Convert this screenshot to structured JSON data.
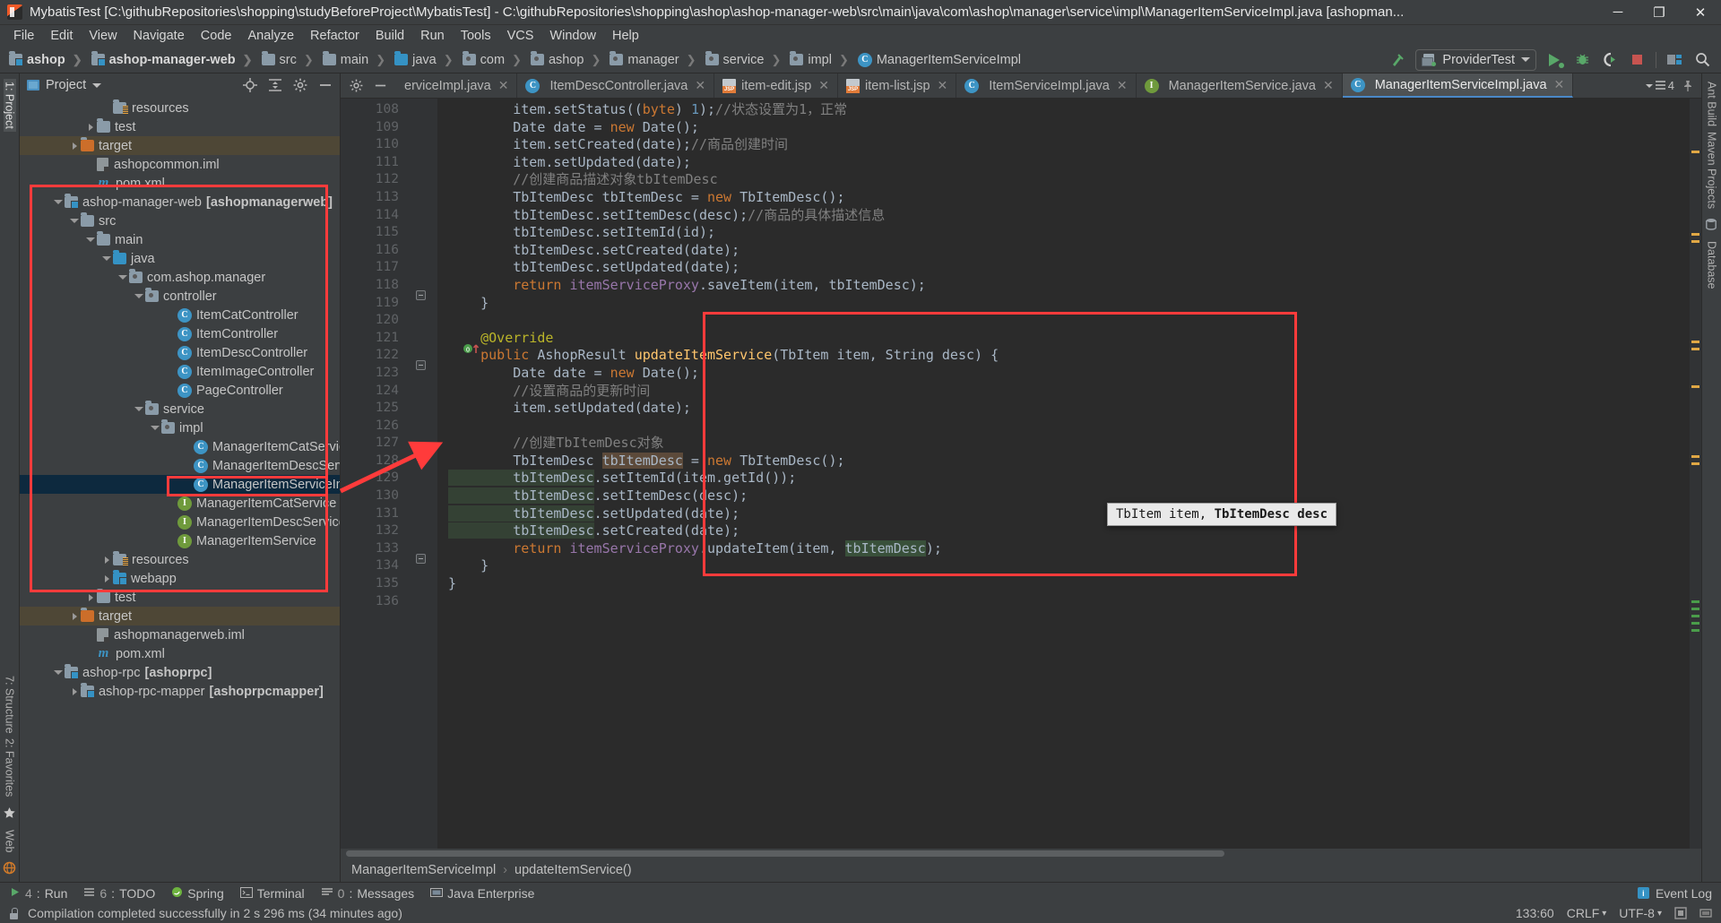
{
  "window": {
    "title": "MybatisTest [C:\\githubRepositories\\shopping\\studyBeforeProject\\MybatisTest] - C:\\githubRepositories\\shopping\\ashop\\ashop-manager-web\\src\\main\\java\\com\\ashop\\manager\\service\\impl\\ManagerItemServiceImpl.java [ashopman...",
    "minimize": "─",
    "maximize": "❐",
    "close": "✕"
  },
  "menu": [
    "File",
    "Edit",
    "View",
    "Navigate",
    "Code",
    "Analyze",
    "Refactor",
    "Build",
    "Run",
    "Tools",
    "VCS",
    "Window",
    "Help"
  ],
  "navbar": {
    "crumbs": [
      {
        "label": "ashop",
        "icon": "module-folder-icon",
        "bold": true
      },
      {
        "label": "ashop-manager-web",
        "icon": "module-folder-icon",
        "bold": true
      },
      {
        "label": "src",
        "icon": "folder-icon",
        "bold": false
      },
      {
        "label": "main",
        "icon": "folder-icon",
        "bold": false
      },
      {
        "label": "java",
        "icon": "source-folder-icon",
        "bold": false
      },
      {
        "label": "com",
        "icon": "package-icon",
        "bold": false
      },
      {
        "label": "ashop",
        "icon": "package-icon",
        "bold": false
      },
      {
        "label": "manager",
        "icon": "package-icon",
        "bold": false
      },
      {
        "label": "service",
        "icon": "package-icon",
        "bold": false
      },
      {
        "label": "impl",
        "icon": "package-icon",
        "bold": false
      },
      {
        "label": "ManagerItemServiceImpl",
        "icon": "class-icon",
        "bold": false
      }
    ],
    "run_config": "ProviderTest"
  },
  "project_panel": {
    "title": "Project",
    "tree": [
      {
        "indent": 5,
        "label": "resources",
        "icon": "resources-folder-icon",
        "arrow": "none",
        "state": "normal"
      },
      {
        "indent": 4,
        "label": "test",
        "icon": "folder-icon",
        "arrow": "closed",
        "state": "normal"
      },
      {
        "indent": 3,
        "label": "target",
        "icon": "target-folder-icon",
        "arrow": "closed",
        "state": "target"
      },
      {
        "indent": 4,
        "label": "ashopcommon.iml",
        "icon": "iml-icon",
        "arrow": "none",
        "state": "normal"
      },
      {
        "indent": 4,
        "label": "pom.xml",
        "icon": "maven-icon",
        "arrow": "none",
        "state": "normal"
      },
      {
        "indent": 2,
        "label": "ashop-manager-web",
        "suffix": "[ashopmanagerweb]",
        "icon": "module-folder-icon",
        "arrow": "open",
        "state": "normal"
      },
      {
        "indent": 3,
        "label": "src",
        "icon": "folder-icon",
        "arrow": "open",
        "state": "normal"
      },
      {
        "indent": 4,
        "label": "main",
        "icon": "folder-icon",
        "arrow": "open",
        "state": "normal"
      },
      {
        "indent": 5,
        "label": "java",
        "icon": "source-folder-icon",
        "arrow": "open",
        "state": "normal"
      },
      {
        "indent": 6,
        "label": "com.ashop.manager",
        "icon": "package-icon",
        "arrow": "open",
        "state": "normal"
      },
      {
        "indent": 7,
        "label": "controller",
        "icon": "package-icon",
        "arrow": "open",
        "state": "normal"
      },
      {
        "indent": 9,
        "label": "ItemCatController",
        "icon": "class-icon",
        "arrow": "none",
        "state": "normal"
      },
      {
        "indent": 9,
        "label": "ItemController",
        "icon": "class-icon",
        "arrow": "none",
        "state": "normal"
      },
      {
        "indent": 9,
        "label": "ItemDescController",
        "icon": "class-icon",
        "arrow": "none",
        "state": "normal"
      },
      {
        "indent": 9,
        "label": "ItemImageController",
        "icon": "class-icon",
        "arrow": "none",
        "state": "normal"
      },
      {
        "indent": 9,
        "label": "PageController",
        "icon": "class-icon",
        "arrow": "none",
        "state": "normal"
      },
      {
        "indent": 7,
        "label": "service",
        "icon": "package-icon",
        "arrow": "open",
        "state": "normal"
      },
      {
        "indent": 8,
        "label": "impl",
        "icon": "package-icon",
        "arrow": "open",
        "state": "normal"
      },
      {
        "indent": 10,
        "label": "ManagerItemCatServiceIm",
        "icon": "class-icon",
        "arrow": "none",
        "state": "normal"
      },
      {
        "indent": 10,
        "label": "ManagerItemDescServiceI",
        "icon": "class-icon",
        "arrow": "none",
        "state": "normal"
      },
      {
        "indent": 10,
        "label": "ManagerItemServiceImpl",
        "icon": "class-icon",
        "arrow": "none",
        "state": "selected"
      },
      {
        "indent": 9,
        "label": "ManagerItemCatService",
        "icon": "interface-icon",
        "arrow": "none",
        "state": "normal"
      },
      {
        "indent": 9,
        "label": "ManagerItemDescService",
        "icon": "interface-icon",
        "arrow": "none",
        "state": "normal"
      },
      {
        "indent": 9,
        "label": "ManagerItemService",
        "icon": "interface-icon",
        "arrow": "none",
        "state": "normal"
      },
      {
        "indent": 5,
        "label": "resources",
        "icon": "resources-folder-icon",
        "arrow": "closed",
        "state": "normal"
      },
      {
        "indent": 5,
        "label": "webapp",
        "icon": "web-folder-icon",
        "arrow": "closed",
        "state": "normal"
      },
      {
        "indent": 4,
        "label": "test",
        "icon": "folder-icon",
        "arrow": "closed",
        "state": "normal"
      },
      {
        "indent": 3,
        "label": "target",
        "icon": "target-folder-icon",
        "arrow": "closed",
        "state": "target"
      },
      {
        "indent": 4,
        "label": "ashopmanagerweb.iml",
        "icon": "iml-icon",
        "arrow": "none",
        "state": "normal"
      },
      {
        "indent": 4,
        "label": "pom.xml",
        "icon": "maven-icon",
        "arrow": "none",
        "state": "normal"
      },
      {
        "indent": 2,
        "label": "ashop-rpc",
        "suffix": "[ashoprpc]",
        "icon": "module-folder-icon",
        "arrow": "open",
        "state": "normal"
      },
      {
        "indent": 3,
        "label": "ashop-rpc-mapper",
        "suffix": "[ashoprpcmapper]",
        "icon": "module-folder-icon",
        "arrow": "closed",
        "state": "normal"
      }
    ]
  },
  "left_rail": [
    "1: Project",
    "7: Structure",
    "2: Favorites",
    "Web"
  ],
  "right_rail": [
    "Ant Build",
    "Maven Projects",
    "Database"
  ],
  "editor": {
    "tabs": [
      {
        "label": "erviceImpl.java",
        "icon": "class-icon",
        "active": false,
        "truncated": true
      },
      {
        "label": "ItemDescController.java",
        "icon": "class-icon",
        "active": false
      },
      {
        "label": "item-edit.jsp",
        "icon": "jsp-icon",
        "active": false
      },
      {
        "label": "item-list.jsp",
        "icon": "jsp-icon",
        "active": false
      },
      {
        "label": "ItemServiceImpl.java",
        "icon": "class-icon",
        "active": false
      },
      {
        "label": "ManagerItemService.java",
        "icon": "interface-icon",
        "active": false
      },
      {
        "label": "ManagerItemServiceImpl.java",
        "icon": "class-icon",
        "active": true
      }
    ],
    "tabs_overflow_count": "4",
    "first_line_number": 108,
    "lines": [
      {
        "n": 108,
        "tokens": [
          {
            "t": "        item.setStatus((",
            "c": "plain"
          },
          {
            "t": "byte",
            "c": "kw"
          },
          {
            "t": ") ",
            "c": "plain"
          },
          {
            "t": "1",
            "c": "num"
          },
          {
            "t": ");",
            "c": "plain"
          },
          {
            "t": "//状态设置为1，正常",
            "c": "cmt"
          }
        ]
      },
      {
        "n": 109,
        "tokens": [
          {
            "t": "        Date date = ",
            "c": "plain"
          },
          {
            "t": "new",
            "c": "kw"
          },
          {
            "t": " Date();",
            "c": "plain"
          }
        ]
      },
      {
        "n": 110,
        "tokens": [
          {
            "t": "        item.setCreated(date);",
            "c": "plain"
          },
          {
            "t": "//商品创建时间",
            "c": "cmt"
          }
        ]
      },
      {
        "n": 111,
        "tokens": [
          {
            "t": "        item.setUpdated(date);",
            "c": "plain"
          }
        ]
      },
      {
        "n": 112,
        "tokens": [
          {
            "t": "        //创建商品描述对象tbItemDesc",
            "c": "cmt"
          }
        ]
      },
      {
        "n": 113,
        "tokens": [
          {
            "t": "        TbItemDesc tbItemDesc = ",
            "c": "plain"
          },
          {
            "t": "new",
            "c": "kw"
          },
          {
            "t": " TbItemDesc();",
            "c": "plain"
          }
        ]
      },
      {
        "n": 114,
        "tokens": [
          {
            "t": "        tbItemDesc.setItemDesc(desc);",
            "c": "plain"
          },
          {
            "t": "//商品的具体描述信息",
            "c": "cmt"
          }
        ]
      },
      {
        "n": 115,
        "tokens": [
          {
            "t": "        tbItemDesc.setItemId(id);",
            "c": "plain"
          }
        ]
      },
      {
        "n": 116,
        "tokens": [
          {
            "t": "        tbItemDesc.setCreated(date);",
            "c": "plain"
          }
        ]
      },
      {
        "n": 117,
        "tokens": [
          {
            "t": "        tbItemDesc.setUpdated(date);",
            "c": "plain"
          }
        ]
      },
      {
        "n": 118,
        "tokens": [
          {
            "t": "        ",
            "c": "plain"
          },
          {
            "t": "return",
            "c": "kw"
          },
          {
            "t": " ",
            "c": "plain"
          },
          {
            "t": "itemServiceProxy",
            "c": "fld"
          },
          {
            "t": ".saveItem(item, tbItemDesc);",
            "c": "plain"
          }
        ]
      },
      {
        "n": 119,
        "tokens": [
          {
            "t": "    }",
            "c": "plain"
          }
        ]
      },
      {
        "n": 120,
        "tokens": []
      },
      {
        "n": 121,
        "tokens": [
          {
            "t": "    ",
            "c": "plain"
          },
          {
            "t": "@Override",
            "c": "ann"
          }
        ]
      },
      {
        "n": 122,
        "tokens": [
          {
            "t": "    ",
            "c": "plain"
          },
          {
            "t": "public",
            "c": "kw"
          },
          {
            "t": " AshopResult ",
            "c": "plain"
          },
          {
            "t": "updateItemService",
            "c": "mth"
          },
          {
            "t": "(TbItem item, String desc) {",
            "c": "plain"
          }
        ]
      },
      {
        "n": 123,
        "tokens": [
          {
            "t": "        Date date = ",
            "c": "plain"
          },
          {
            "t": "new",
            "c": "kw"
          },
          {
            "t": " Date();",
            "c": "plain"
          }
        ]
      },
      {
        "n": 124,
        "tokens": [
          {
            "t": "        //设置商品的更新时间",
            "c": "cmt"
          }
        ]
      },
      {
        "n": 125,
        "tokens": [
          {
            "t": "        item.setUpdated(date);",
            "c": "plain"
          }
        ]
      },
      {
        "n": 126,
        "tokens": []
      },
      {
        "n": 127,
        "tokens": [
          {
            "t": "        //创建TbItemDesc对象",
            "c": "cmt"
          }
        ]
      },
      {
        "n": 128,
        "tokens": [
          {
            "t": "        TbItemDesc ",
            "c": "plain"
          },
          {
            "t": "tbItemDesc",
            "c": "hl-b"
          },
          {
            "t": " = ",
            "c": "plain"
          },
          {
            "t": "new",
            "c": "kw"
          },
          {
            "t": " TbItemDesc();",
            "c": "plain"
          }
        ]
      },
      {
        "n": 129,
        "tokens": [
          {
            "t": "        tbItemDesc",
            "c": "hl-c"
          },
          {
            "t": ".setItemId(item.getId());",
            "c": "plain"
          }
        ]
      },
      {
        "n": 130,
        "tokens": [
          {
            "t": "        tbItemDesc",
            "c": "hl-c"
          },
          {
            "t": ".setItemDesc(desc);",
            "c": "plain"
          }
        ]
      },
      {
        "n": 131,
        "tokens": [
          {
            "t": "        tbItemDesc",
            "c": "hl-c"
          },
          {
            "t": ".setUpdated(date);",
            "c": "plain"
          }
        ]
      },
      {
        "n": 132,
        "tokens": [
          {
            "t": "        tbItemDesc",
            "c": "hl-c"
          },
          {
            "t": ".setCreated(date);",
            "c": "plain"
          }
        ]
      },
      {
        "n": 133,
        "tokens": [
          {
            "t": "        ",
            "c": "plain"
          },
          {
            "t": "return",
            "c": "kw"
          },
          {
            "t": " ",
            "c": "plain"
          },
          {
            "t": "itemServiceProxy",
            "c": "fld"
          },
          {
            "t": ".updateItem(item, ",
            "c": "plain"
          },
          {
            "t": "tbItemDesc",
            "c": "hl-g"
          },
          {
            "t": ");",
            "c": "plain"
          }
        ]
      },
      {
        "n": 134,
        "tokens": [
          {
            "t": "    }",
            "c": "plain"
          }
        ]
      },
      {
        "n": 135,
        "tokens": [
          {
            "t": "}",
            "c": "plain"
          }
        ]
      },
      {
        "n": 136,
        "tokens": []
      }
    ],
    "tooltip": {
      "prefix": "TbItem item, ",
      "bold": "TbItemDesc desc"
    },
    "breadcrumbs": [
      "ManagerItemServiceImpl",
      "updateItemService()"
    ]
  },
  "bottom_bar": {
    "items": [
      {
        "num": "4",
        "label": "Run",
        "icon": "run-icon"
      },
      {
        "num": "6",
        "label": "TODO",
        "icon": "todo-icon"
      },
      {
        "num": "",
        "label": "Spring",
        "icon": "spring-icon"
      },
      {
        "num": "",
        "label": "Terminal",
        "icon": "terminal-icon"
      },
      {
        "num": "0",
        "label": "Messages",
        "icon": "messages-icon"
      },
      {
        "num": "",
        "label": "Java Enterprise",
        "icon": "java-enterprise-icon"
      }
    ],
    "event_log": "Event Log"
  },
  "status_bar": {
    "message": "Compilation completed successfully in 2 s 296 ms (34 minutes ago)",
    "caret": "133:60",
    "line_sep": "CRLF",
    "encoding": "UTF-8"
  },
  "colors": {
    "accent": "#4a88c7",
    "annotation_red": "#ff3b3b",
    "selection": "#0d293e",
    "target_folder": "#4e4736",
    "green": "#59a869"
  }
}
